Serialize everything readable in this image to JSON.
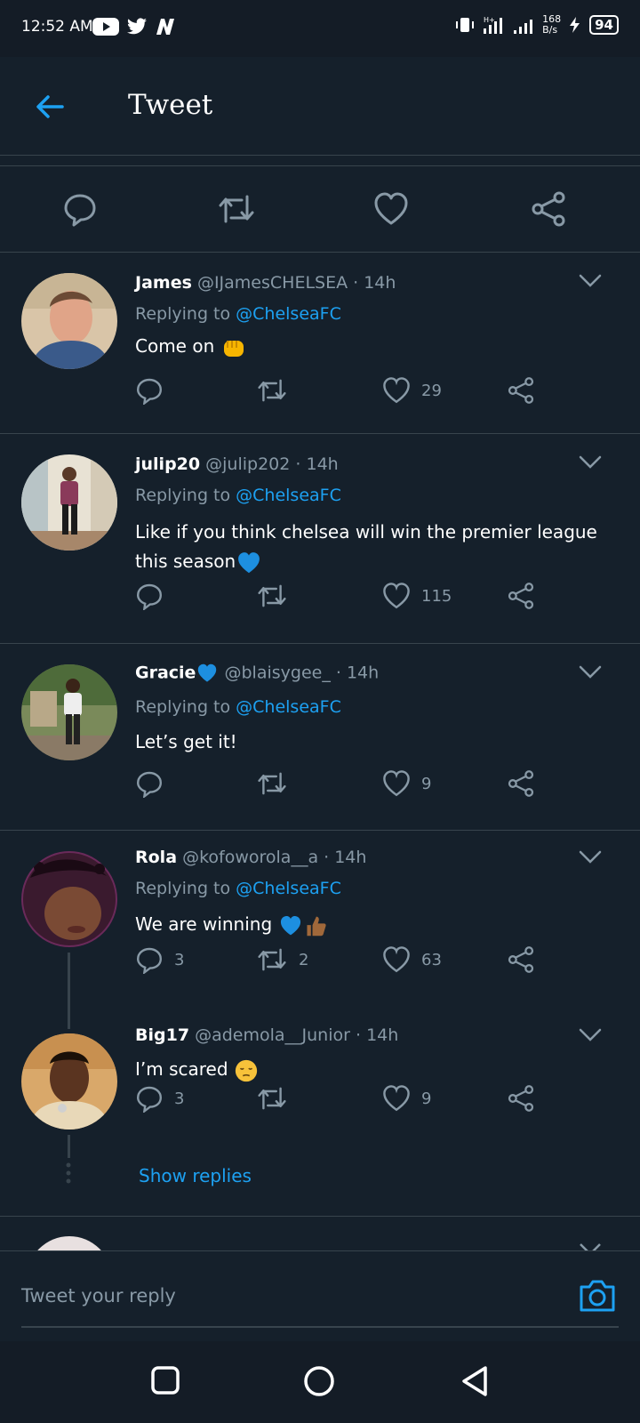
{
  "status_bar": {
    "time": "12:52 AM",
    "network_speed": "168\nB/s",
    "battery": "94"
  },
  "header": {
    "title": "Tweet"
  },
  "tweets": [
    {
      "name": "James",
      "handle": "@IJamesCHELSEA",
      "time": "· 14h",
      "replying_prefix": "Replying to ",
      "replying_to": "@ChelseaFC",
      "text": "Come on",
      "likes": "29",
      "replies": "",
      "retweets": ""
    },
    {
      "name": "julip20",
      "handle": "@julip202",
      "time": "· 14h",
      "replying_prefix": "Replying to ",
      "replying_to": "@ChelseaFC",
      "text": "Like if you think chelsea will win the premier league this season",
      "likes": "115",
      "replies": "",
      "retweets": ""
    },
    {
      "name": "Gracie",
      "handle": "@blaisygee_",
      "time": "· 14h",
      "replying_prefix": "Replying to ",
      "replying_to": "@ChelseaFC",
      "text": "Let’s get it!",
      "likes": "9",
      "replies": "",
      "retweets": ""
    },
    {
      "name": "Rola",
      "handle": "@kofoworola__a",
      "time": "· 14h",
      "replying_prefix": "Replying to ",
      "replying_to": "@ChelseaFC",
      "text": "We are winning",
      "likes": "63",
      "replies": "3",
      "retweets": "2"
    },
    {
      "name": "Big17",
      "handle": "@ademola__Junior",
      "time": "· 14h",
      "text": "I’m scared",
      "likes": "9",
      "replies": "3",
      "retweets": ""
    }
  ],
  "show_replies": "Show replies",
  "reply_bar": {
    "placeholder": "Tweet your reply"
  },
  "colors": {
    "background": "#15202b",
    "accent": "#1da1f2",
    "muted": "#8899a6",
    "divider": "#38444d",
    "like_pink": "#e0245e"
  }
}
